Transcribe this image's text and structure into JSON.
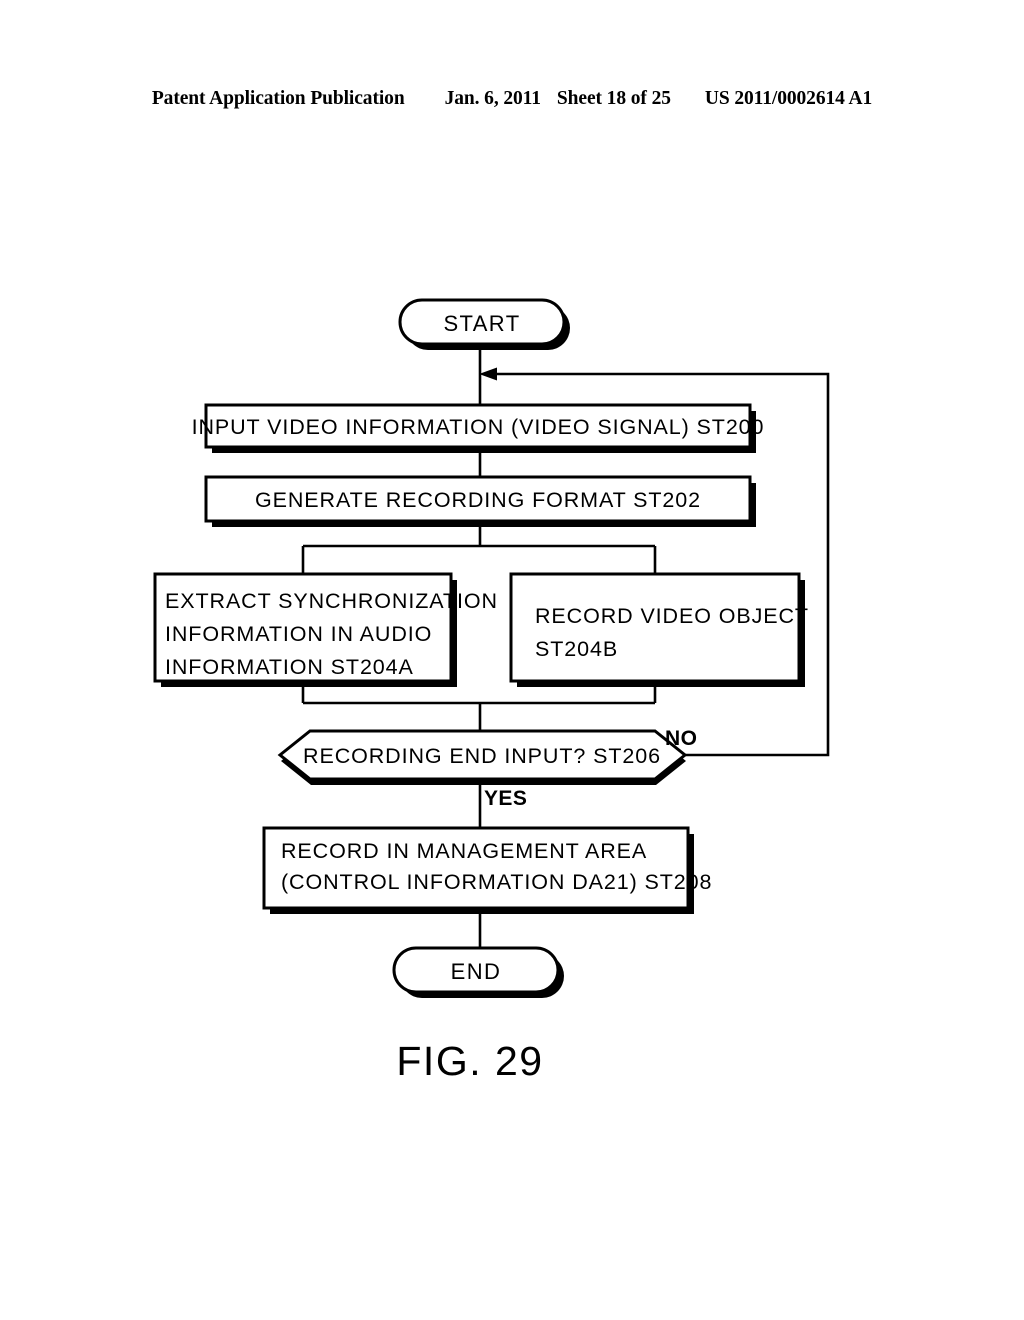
{
  "header": {
    "publication": "Patent Application Publication",
    "date": "Jan. 6, 2011",
    "sheet": "Sheet 18 of 25",
    "patent_number": "US 2011/0002614 A1"
  },
  "figure": {
    "caption": "FIG. 29",
    "nodes": {
      "start": {
        "label": "START"
      },
      "st200": {
        "label": "INPUT VIDEO INFORMATION (VIDEO SIGNAL) ST200"
      },
      "st202": {
        "label": "GENERATE RECORDING FORMAT ST202"
      },
      "st204a": {
        "line1": "EXTRACT SYNCHRONIZATION",
        "line2": "INFORMATION IN AUDIO",
        "line3": "INFORMATION ST204A"
      },
      "st204b": {
        "line1": "RECORD VIDEO OBJECT",
        "line2": "ST204B"
      },
      "st206": {
        "label": "RECORDING END INPUT? ST206"
      },
      "st208": {
        "line1": "RECORD IN MANAGEMENT AREA",
        "line2": "(CONTROL INFORMATION DA21) ST208"
      },
      "end": {
        "label": "END"
      }
    },
    "edge_labels": {
      "no": "NO",
      "yes": "YES"
    },
    "colors": {
      "ink": "#000000",
      "paper": "#ffffff"
    }
  },
  "chart_data": {
    "type": "diagram",
    "title": "FIG. 29",
    "diagram_kind": "flowchart",
    "nodes": [
      {
        "id": "start",
        "kind": "terminal",
        "text": "START"
      },
      {
        "id": "st200",
        "kind": "process",
        "text": "INPUT VIDEO INFORMATION (VIDEO SIGNAL) ST200"
      },
      {
        "id": "st202",
        "kind": "process",
        "text": "GENERATE RECORDING FORMAT ST202"
      },
      {
        "id": "st204a",
        "kind": "process",
        "text": "EXTRACT SYNCHRONIZATION INFORMATION IN AUDIO INFORMATION ST204A"
      },
      {
        "id": "st204b",
        "kind": "process",
        "text": "RECORD VIDEO OBJECT ST204B"
      },
      {
        "id": "st206",
        "kind": "decision",
        "text": "RECORDING END INPUT? ST206"
      },
      {
        "id": "st208",
        "kind": "process",
        "text": "RECORD IN MANAGEMENT AREA (CONTROL INFORMATION DA21) ST208"
      },
      {
        "id": "end",
        "kind": "terminal",
        "text": "END"
      }
    ],
    "edges": [
      {
        "from": "start",
        "to": "st200",
        "label": ""
      },
      {
        "from": "st200",
        "to": "st202",
        "label": ""
      },
      {
        "from": "st202",
        "to": "st204a",
        "label": ""
      },
      {
        "from": "st202",
        "to": "st204b",
        "label": ""
      },
      {
        "from": "st204a",
        "to": "st206",
        "label": ""
      },
      {
        "from": "st204b",
        "to": "st206",
        "label": ""
      },
      {
        "from": "st206",
        "to": "st208",
        "label": "YES"
      },
      {
        "from": "st206",
        "to": "st200",
        "label": "NO"
      },
      {
        "from": "st208",
        "to": "end",
        "label": ""
      }
    ]
  }
}
